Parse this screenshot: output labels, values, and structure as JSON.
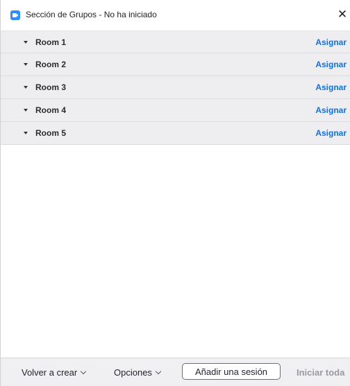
{
  "window": {
    "title": "Sección de Grupos - No ha iniciado",
    "close_glyph": "✕"
  },
  "rooms": [
    {
      "name": "Room 1",
      "action": "Asignar"
    },
    {
      "name": "Room 2",
      "action": "Asignar"
    },
    {
      "name": "Room 3",
      "action": "Asignar"
    },
    {
      "name": "Room 4",
      "action": "Asignar"
    },
    {
      "name": "Room 5",
      "action": "Asignar"
    }
  ],
  "footer": {
    "recreate_label": "Volver a crear",
    "options_label": "Opciones",
    "add_session_label": "Añadir una sesión",
    "start_all_label": "Iniciar toda"
  },
  "icons": {
    "app": "zoom-icon",
    "close": "close-icon",
    "expand": "caret-down-icon",
    "dropdown": "chevron-down-icon"
  },
  "colors": {
    "accent": "#0e71eb",
    "app_icon": "#2d8cff",
    "row_bg": "#eeeef0",
    "disabled": "#9a9aa0"
  }
}
